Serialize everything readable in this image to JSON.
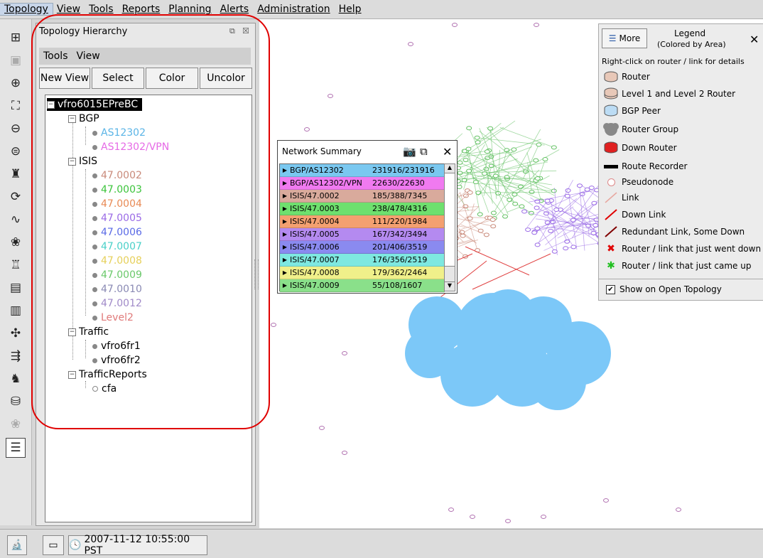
{
  "menu": [
    "Topology",
    "View",
    "Tools",
    "Reports",
    "Planning",
    "Alerts",
    "Administration",
    "Help"
  ],
  "toolbar_icons": [
    "hierarchy-icon",
    "save-icon",
    "zoom-in-icon",
    "fit-icon",
    "zoom-out-icon",
    "layout-icon",
    "router-find-icon",
    "refresh-icon",
    "graph-icon",
    "group-icon",
    "router-search-icon",
    "report-icon",
    "chart-icon",
    "traffic-icon",
    "import-icon",
    "down-router-icon",
    "database-icon",
    "group-disabled-icon",
    "list-icon"
  ],
  "panel": {
    "title": "Topology Hierarchy",
    "tabs": [
      "Tools",
      "View"
    ],
    "buttons": [
      "New View",
      "Select",
      "Color",
      "Uncolor"
    ],
    "tree": {
      "root": "vfro6015EPreBC",
      "bgp": {
        "label": "BGP",
        "children": [
          {
            "label": "AS12302",
            "color": "#5ab4e6"
          },
          {
            "label": "AS12302/VPN",
            "color": "#e66ae6"
          }
        ]
      },
      "isis": {
        "label": "ISIS",
        "children": [
          {
            "label": "47.0002",
            "color": "#c98a7a"
          },
          {
            "label": "47.0003",
            "color": "#3cc43c"
          },
          {
            "label": "47.0004",
            "color": "#e88a55"
          },
          {
            "label": "47.0005",
            "color": "#9a6ae6"
          },
          {
            "label": "47.0006",
            "color": "#5a6ae6"
          },
          {
            "label": "47.0007",
            "color": "#4ad0c8"
          },
          {
            "label": "47.0008",
            "color": "#e6d05a"
          },
          {
            "label": "47.0009",
            "color": "#6ac86a"
          },
          {
            "label": "47.0010",
            "color": "#8a8ab4"
          },
          {
            "label": "47.0012",
            "color": "#a08ac8"
          },
          {
            "label": "Level2",
            "color": "#e07a7a"
          }
        ]
      },
      "traffic": {
        "label": "Traffic",
        "children": [
          {
            "label": "vfro6fr1",
            "color": "#000000"
          },
          {
            "label": "vfro6fr2",
            "color": "#000000"
          }
        ]
      },
      "reports": {
        "label": "TrafficReports",
        "children": [
          {
            "label": "cfa",
            "color": "#000000"
          }
        ]
      }
    }
  },
  "network_summary": {
    "title": "Network Summary",
    "rows": [
      {
        "name": "BGP/AS12302",
        "value": "231916/231916",
        "color": "#7ac8f0"
      },
      {
        "name": "BGP/AS12302/VPN",
        "value": "22630/22630",
        "color": "#f07af0"
      },
      {
        "name": "ISIS/47.0002",
        "value": "185/388/7345",
        "color": "#d9aa9c"
      },
      {
        "name": "ISIS/47.0003",
        "value": "238/478/4316",
        "color": "#6ee06e"
      },
      {
        "name": "ISIS/47.0004",
        "value": "111/220/1984",
        "color": "#f4a070"
      },
      {
        "name": "ISIS/47.0005",
        "value": "167/342/3494",
        "color": "#b48af0"
      },
      {
        "name": "ISIS/47.0006",
        "value": "201/406/3519",
        "color": "#8a8af0"
      },
      {
        "name": "ISIS/47.0007",
        "value": "176/356/2519",
        "color": "#7ee8e0"
      },
      {
        "name": "ISIS/47.0008",
        "value": "179/362/2464",
        "color": "#f0f08a"
      },
      {
        "name": "ISIS/47.0009",
        "value": "55/108/1607",
        "color": "#8ae08a"
      }
    ]
  },
  "legend": {
    "more_label": "More",
    "title": "Legend",
    "subtitle": "(Colored by Area)",
    "hint": "Right-click on router / link for details",
    "items": [
      {
        "label": "Router",
        "icon": "router-icon"
      },
      {
        "label": "Level 1 and Level 2 Router",
        "icon": "l1l2-router-icon"
      },
      {
        "label": "BGP Peer",
        "icon": "bgp-peer-icon"
      },
      {
        "label": "Router Group",
        "icon": "router-group-icon"
      },
      {
        "label": "Down Router",
        "icon": "down-router-icon"
      },
      {
        "label": "Route Recorder",
        "icon": "route-recorder-icon"
      },
      {
        "label": "Pseudonode",
        "icon": "pseudonode-icon"
      },
      {
        "label": "Link",
        "icon": "link-icon"
      },
      {
        "label": "Down Link",
        "icon": "down-link-icon"
      },
      {
        "label": "Redundant Link, Some Down",
        "icon": "redundant-link-icon"
      },
      {
        "label": "Router / link that just went down",
        "icon": "went-down-icon"
      },
      {
        "label": "Router / link that just came up",
        "icon": "came-up-icon"
      }
    ],
    "checkbox_label": "Show on Open Topology",
    "checkbox_checked": true
  },
  "statusbar": {
    "timestamp": "2007-11-12 10:55:00 PST"
  }
}
